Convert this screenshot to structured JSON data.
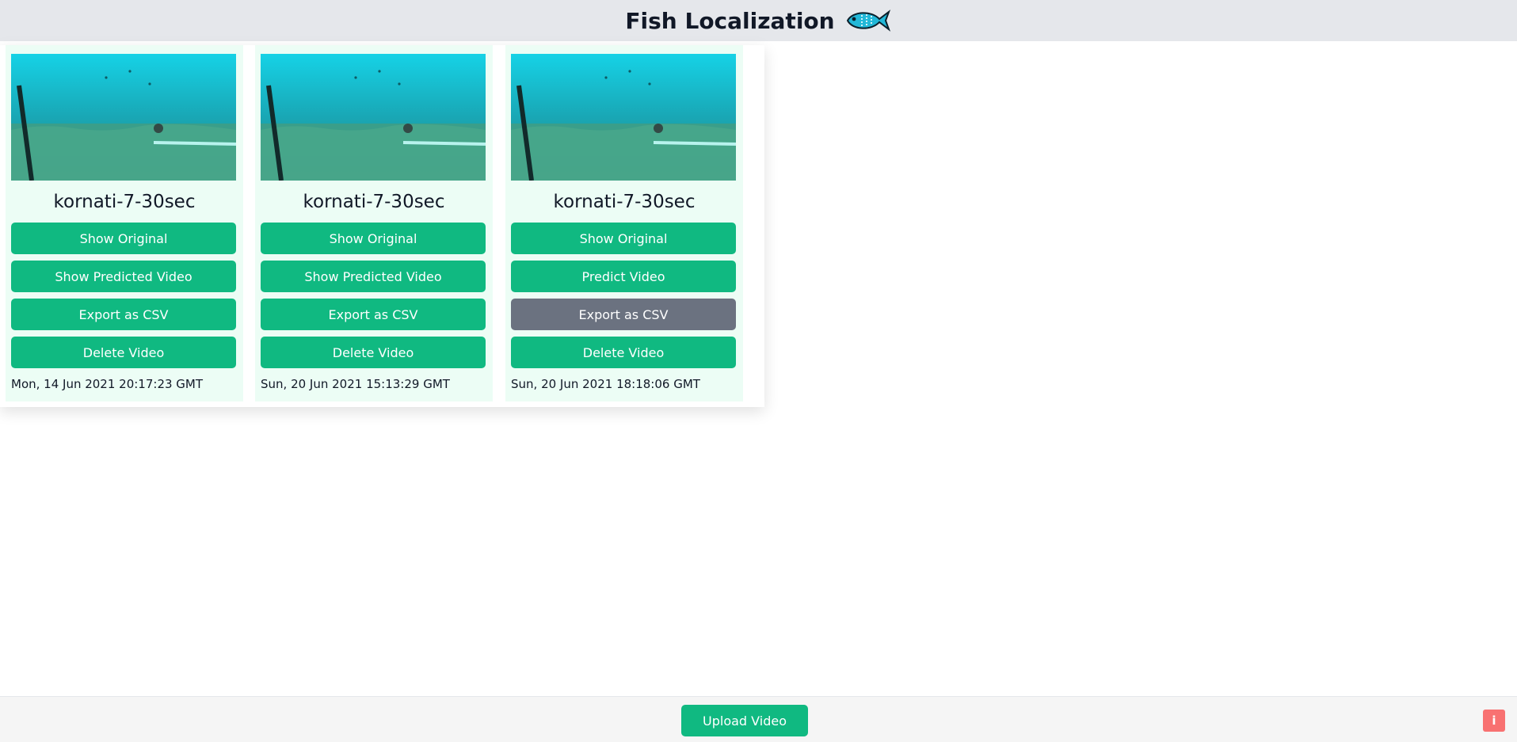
{
  "header": {
    "title": "Fish Localization",
    "icon": "fish-icon"
  },
  "cards": [
    {
      "title": "kornati-7-30sec",
      "thumbnail": "underwater-seagrass-thumbnail",
      "buttons": {
        "show_original": "Show Original",
        "predict": "Show Predicted Video",
        "export": "Export as CSV",
        "delete": "Delete Video"
      },
      "export_disabled": false,
      "date": "Mon, 14 Jun 2021 20:17:23 GMT"
    },
    {
      "title": "kornati-7-30sec",
      "thumbnail": "underwater-seagrass-thumbnail",
      "buttons": {
        "show_original": "Show Original",
        "predict": "Show Predicted Video",
        "export": "Export as CSV",
        "delete": "Delete Video"
      },
      "export_disabled": false,
      "date": "Sun, 20 Jun 2021 15:13:29 GMT"
    },
    {
      "title": "kornati-7-30sec",
      "thumbnail": "underwater-seagrass-thumbnail",
      "buttons": {
        "show_original": "Show Original",
        "predict": "Predict Video",
        "export": "Export as CSV",
        "delete": "Delete Video"
      },
      "export_disabled": true,
      "date": "Sun, 20 Jun 2021 18:18:06 GMT"
    }
  ],
  "footer": {
    "upload_label": "Upload Video",
    "info_label": "i"
  },
  "colors": {
    "primary_button": "#10b981",
    "disabled_button": "#6b7280",
    "card_background": "#ecfdf5",
    "info_button": "#f87171",
    "header_background": "#e5e7eb"
  }
}
